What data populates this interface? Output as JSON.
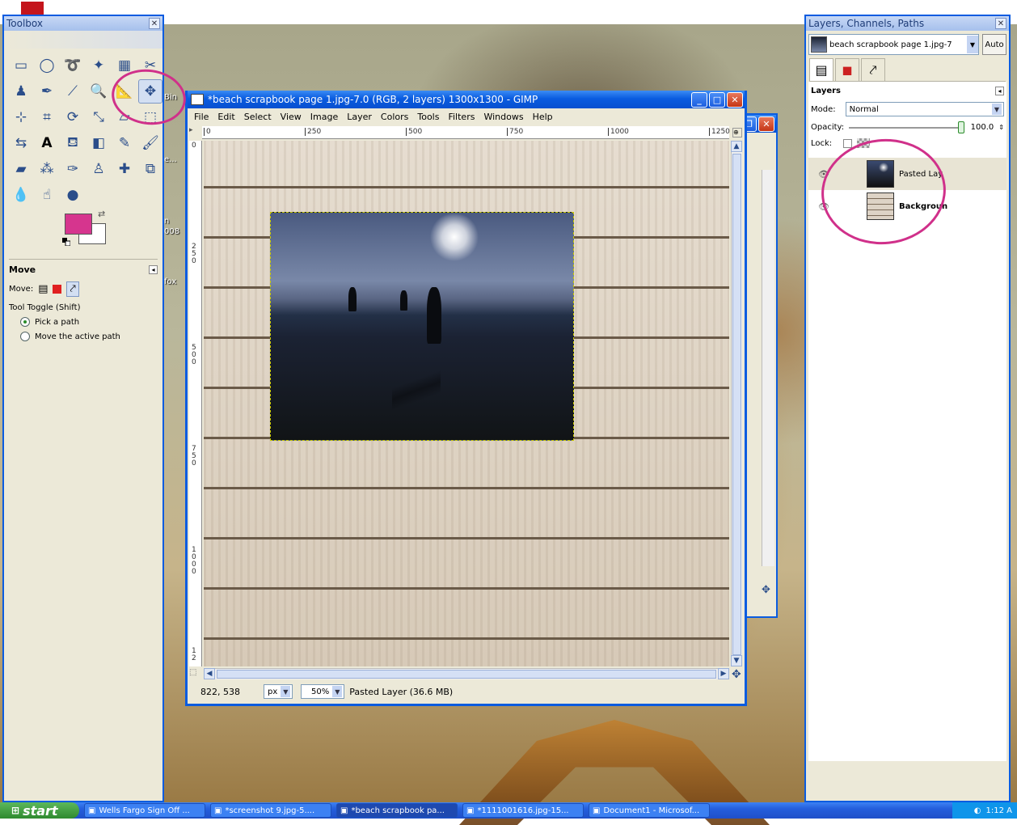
{
  "toolbox": {
    "title": "Toolbox",
    "tools": [
      "rect-select-icon",
      "ellipse-select-icon",
      "free-select-icon",
      "fuzzy-select-icon",
      "select-by-color-icon",
      "scissors-icon",
      "foreground-select-icon",
      "paths-icon",
      "color-picker-icon",
      "zoom-icon",
      "measure-icon",
      "move-icon",
      "align-icon",
      "crop-icon",
      "rotate-icon",
      "scale-icon",
      "shear-icon",
      "perspective-icon",
      "flip-icon",
      "text-icon",
      "bucket-fill-icon",
      "blend-icon",
      "pencil-icon",
      "paintbrush-icon",
      "eraser-icon",
      "airbrush-icon",
      "ink-icon",
      "clone-icon",
      "heal-icon",
      "perspective-clone-icon",
      "blur-icon",
      "smudge-icon",
      "dodge-burn-icon"
    ],
    "fg_color": "#d6358e",
    "bg_color": "#ffffff",
    "options_title": "Move",
    "move_label": "Move:",
    "toggle_label": "Tool Toggle  (Shift)",
    "opt_pick": "Pick a path",
    "opt_move": "Move the active path"
  },
  "desktop_labels": {
    "bin": "Bin",
    "e": "e...",
    "n": "n",
    "year": "008",
    "fox": "fox"
  },
  "image_window": {
    "title": "*beach scrapbook page 1.jpg-7.0 (RGB, 2 layers) 1300x1300 - GIMP",
    "menu": [
      "File",
      "Edit",
      "Select",
      "View",
      "Image",
      "Layer",
      "Colors",
      "Tools",
      "Filters",
      "Windows",
      "Help"
    ],
    "ruler_h": [
      "0",
      "250",
      "500",
      "750",
      "1000",
      "1250"
    ],
    "ruler_v": [
      "0",
      "250",
      "500",
      "750",
      "1000",
      "12"
    ],
    "status": {
      "coords": "822, 538",
      "unit": "px",
      "zoom": "50%",
      "message": "Pasted Layer (36.6 MB)"
    }
  },
  "layers_dock": {
    "title": "Layers, Channels, Paths",
    "image_name": "beach scrapbook page 1.jpg-7",
    "auto_label": "Auto",
    "panel_title": "Layers",
    "mode_label": "Mode:",
    "mode_value": "Normal",
    "opacity_label": "Opacity:",
    "opacity_value": "100.0",
    "lock_label": "Lock:",
    "layers": [
      {
        "name": "Pasted Lay",
        "bold": false
      },
      {
        "name": "Backgroun",
        "bold": true
      }
    ]
  },
  "taskbar": {
    "start": "start",
    "items": [
      "Wells Fargo Sign Off ...",
      "*screenshot 9.jpg-5....",
      "*beach scrapbook pa...",
      "*1111001616.jpg-15...",
      "Document1 - Microsof..."
    ],
    "clock": "1:12 A"
  },
  "colors": {
    "annotation": "#d0308a",
    "xp_blue": "#0a5ce0"
  }
}
